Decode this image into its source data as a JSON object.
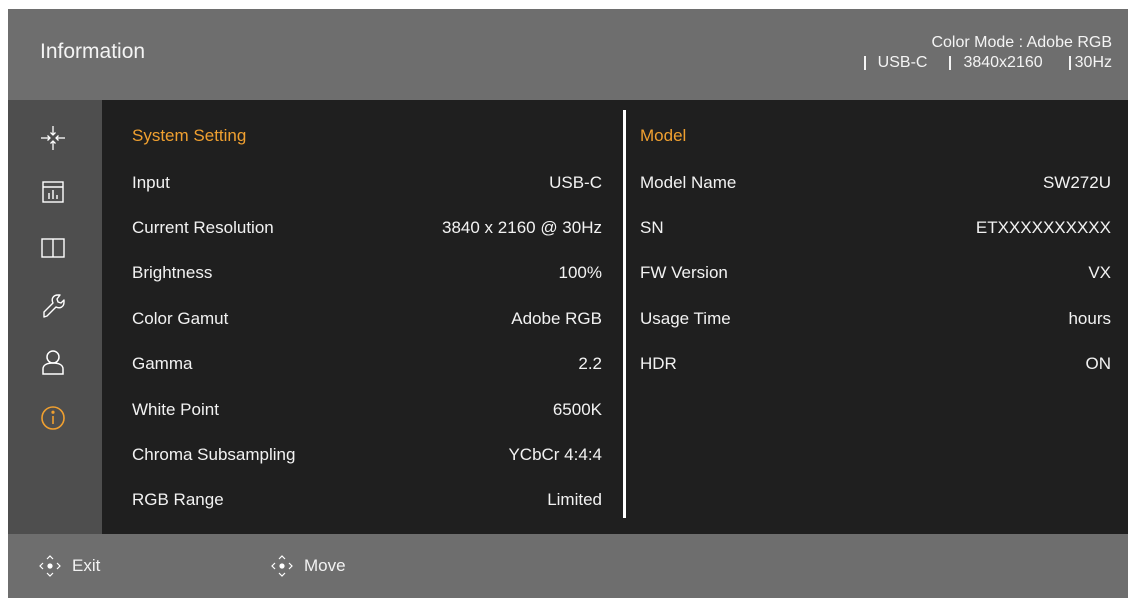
{
  "header": {
    "title": "Information",
    "color_mode": "Color Mode : Adobe RGB",
    "input": "USB-C",
    "resolution": "3840x2160",
    "refresh": "30Hz"
  },
  "sidebar": {
    "items": [
      {
        "icon": "picture-adjust-icon",
        "active": false
      },
      {
        "icon": "color-adjust-icon",
        "active": false
      },
      {
        "icon": "pip-pbp-icon",
        "active": false
      },
      {
        "icon": "system-tools-icon",
        "active": false
      },
      {
        "icon": "custom-user-icon",
        "active": false
      },
      {
        "icon": "information-icon",
        "active": true
      }
    ],
    "active_color": "#f0a030"
  },
  "system": {
    "title": "System Setting",
    "rows": [
      {
        "label": "Input",
        "value": "USB-C"
      },
      {
        "label": "Current Resolution",
        "value": "3840 x 2160 @ 30Hz"
      },
      {
        "label": "Brightness",
        "value": "100%"
      },
      {
        "label": "Color Gamut",
        "value": "Adobe RGB"
      },
      {
        "label": "Gamma",
        "value": "2.2"
      },
      {
        "label": "White Point",
        "value": "6500K"
      },
      {
        "label": "Chroma Subsampling",
        "value": "YCbCr 4:4:4"
      },
      {
        "label": "RGB Range",
        "value": "Limited"
      }
    ]
  },
  "model": {
    "title": "Model",
    "rows": [
      {
        "label": "Model Name",
        "value": "SW272U"
      },
      {
        "label": "SN",
        "value": "ETXXXXXXXXXX"
      },
      {
        "label": "FW Version",
        "value": "VX"
      },
      {
        "label": "Usage Time",
        "value": "hours"
      },
      {
        "label": "HDR",
        "value": "ON"
      }
    ]
  },
  "footer": {
    "exit_label": "Exit",
    "move_label": "Move"
  },
  "colors": {
    "accent": "#f0a030",
    "header_bg": "#6e6e6e",
    "sidebar_bg": "#4e4e4e",
    "content_bg": "#1f1f1f"
  }
}
